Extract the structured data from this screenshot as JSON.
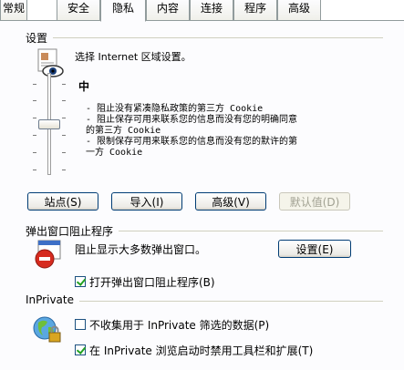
{
  "tabs": [
    {
      "label": "常规",
      "active": false
    },
    {
      "label": "安全",
      "active": false
    },
    {
      "label": "隐私",
      "active": true
    },
    {
      "label": "内容",
      "active": false
    },
    {
      "label": "连接",
      "active": false
    },
    {
      "label": "程序",
      "active": false
    },
    {
      "label": "高级",
      "active": false
    }
  ],
  "settings": {
    "group_title": "设置",
    "description": "选择 Internet 区域设置。",
    "level_title": "中",
    "level_details": [
      "- 阻止没有紧凑隐私政策的第三方 Cookie",
      "- 阻止保存可用来联系您的信息而没有您的明确同意",
      "的第三方 Cookie",
      "- 限制保存可用来联系您的信息而没有您的默许的第",
      "一方 Cookie"
    ],
    "slider_level_fraction": 0.5,
    "buttons": {
      "sites": "站点(S)",
      "import": "导入(I)",
      "advanced": "高级(V)",
      "default": "默认值(D)"
    }
  },
  "popup_blocker": {
    "group_title": "弹出窗口阻止程序",
    "description": "阻止显示大多数弹出窗口。",
    "settings_button": "设置(E)",
    "enable_label": "打开弹出窗口阻止程序(B)",
    "enable_checked": true
  },
  "inprivate": {
    "group_title": "InPrivate",
    "option1_label": "不收集用于 InPrivate 筛选的数据(P)",
    "option1_checked": false,
    "option2_label": "在 InPrivate 浏览启动时禁用工具栏和扩展(T)",
    "option2_checked": true
  },
  "icons": {
    "settings_icon": "document-with-eye-icon",
    "popup_icon": "blocked-window-icon",
    "inprivate_icon": "globe-lock-icon"
  }
}
